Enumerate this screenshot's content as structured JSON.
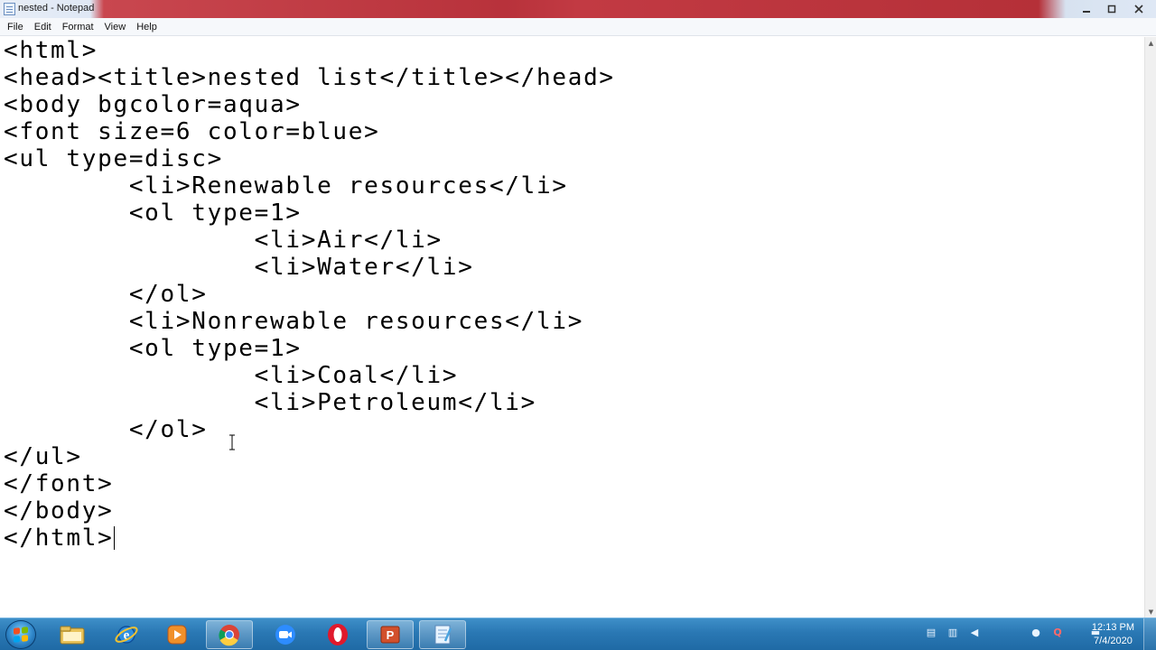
{
  "window": {
    "title": "nested - Notepad",
    "minimize_icon": "minimize-icon",
    "maximize_icon": "maximize-icon",
    "close_icon": "close-icon"
  },
  "menu": {
    "items": [
      "File",
      "Edit",
      "Format",
      "View",
      "Help"
    ]
  },
  "editor": {
    "lines": [
      "<html>",
      "<head><title>nested list</title></head>",
      "<body bgcolor=aqua>",
      "<font size=6 color=blue>",
      "<ul type=disc>",
      "        <li>Renewable resources</li>",
      "        <ol type=1>",
      "                <li>Air</li>",
      "                <li>Water</li>",
      "        </ol>",
      "        <li>Nonrewable resources</li>",
      "        <ol type=1>",
      "                <li>Coal</li>",
      "                <li>Petroleum</li>",
      "        </ol>",
      "</ul>",
      "</font>",
      "</body>",
      "</html>"
    ]
  },
  "taskbar": {
    "apps": [
      "windows-explorer-icon",
      "internet-explorer-icon",
      "media-player-icon",
      "chrome-icon",
      "zoom-icon",
      "opera-icon",
      "powerpoint-icon",
      "notepad-icon"
    ],
    "clock_time": "12:13 PM",
    "clock_date": "7/4/2020"
  },
  "colors": {
    "titlebar_accent": "#b8323b",
    "taskbar": "#2a78b4"
  }
}
